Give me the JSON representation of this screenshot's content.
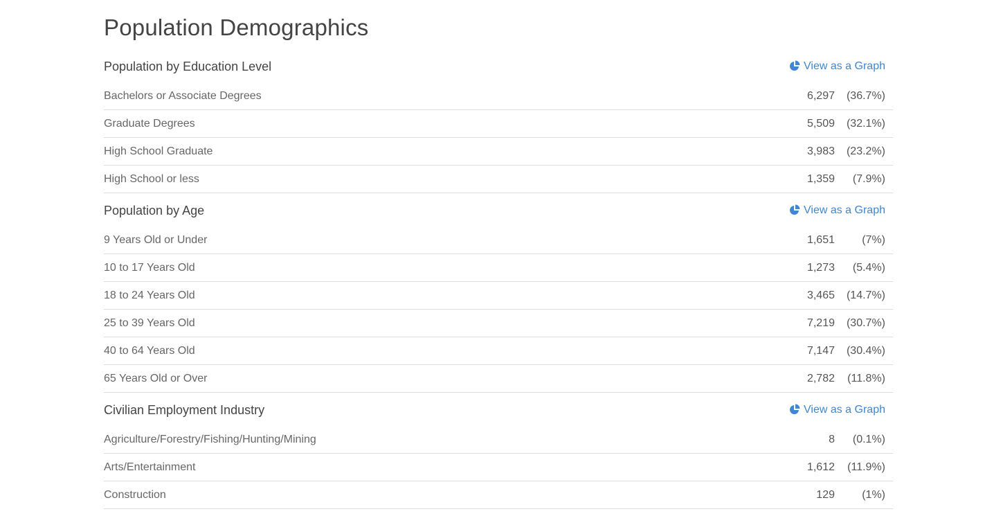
{
  "page_title": "Population Demographics",
  "accent_color": "#3f86d4",
  "sections": [
    {
      "title": "Population by Education Level",
      "link_label": "View as a Graph",
      "link_icon": "pie-chart-icon",
      "rows": [
        {
          "label": "Bachelors or Associate Degrees",
          "value": "6,297",
          "pct": "(36.7%)"
        },
        {
          "label": "Graduate Degrees",
          "value": "5,509",
          "pct": "(32.1%)"
        },
        {
          "label": "High School Graduate",
          "value": "3,983",
          "pct": "(23.2%)"
        },
        {
          "label": "High School or less",
          "value": "1,359",
          "pct": "(7.9%)"
        }
      ]
    },
    {
      "title": "Population by Age",
      "link_label": "View as a Graph",
      "link_icon": "pie-chart-icon",
      "rows": [
        {
          "label": "9 Years Old or Under",
          "value": "1,651",
          "pct": "(7%)"
        },
        {
          "label": "10 to 17 Years Old",
          "value": "1,273",
          "pct": "(5.4%)"
        },
        {
          "label": "18 to 24 Years Old",
          "value": "3,465",
          "pct": "(14.7%)"
        },
        {
          "label": "25 to 39 Years Old",
          "value": "7,219",
          "pct": "(30.7%)"
        },
        {
          "label": "40 to 64 Years Old",
          "value": "7,147",
          "pct": "(30.4%)"
        },
        {
          "label": "65 Years Old or Over",
          "value": "2,782",
          "pct": "(11.8%)"
        }
      ]
    },
    {
      "title": "Civilian Employment Industry",
      "link_label": "View as a Graph",
      "link_icon": "pie-chart-icon",
      "rows": [
        {
          "label": "Agriculture/Forestry/Fishing/Hunting/Mining",
          "value": "8",
          "pct": "(0.1%)"
        },
        {
          "label": "Arts/Entertainment",
          "value": "1,612",
          "pct": "(11.9%)"
        },
        {
          "label": "Construction",
          "value": "129",
          "pct": "(1%)"
        }
      ]
    }
  ]
}
